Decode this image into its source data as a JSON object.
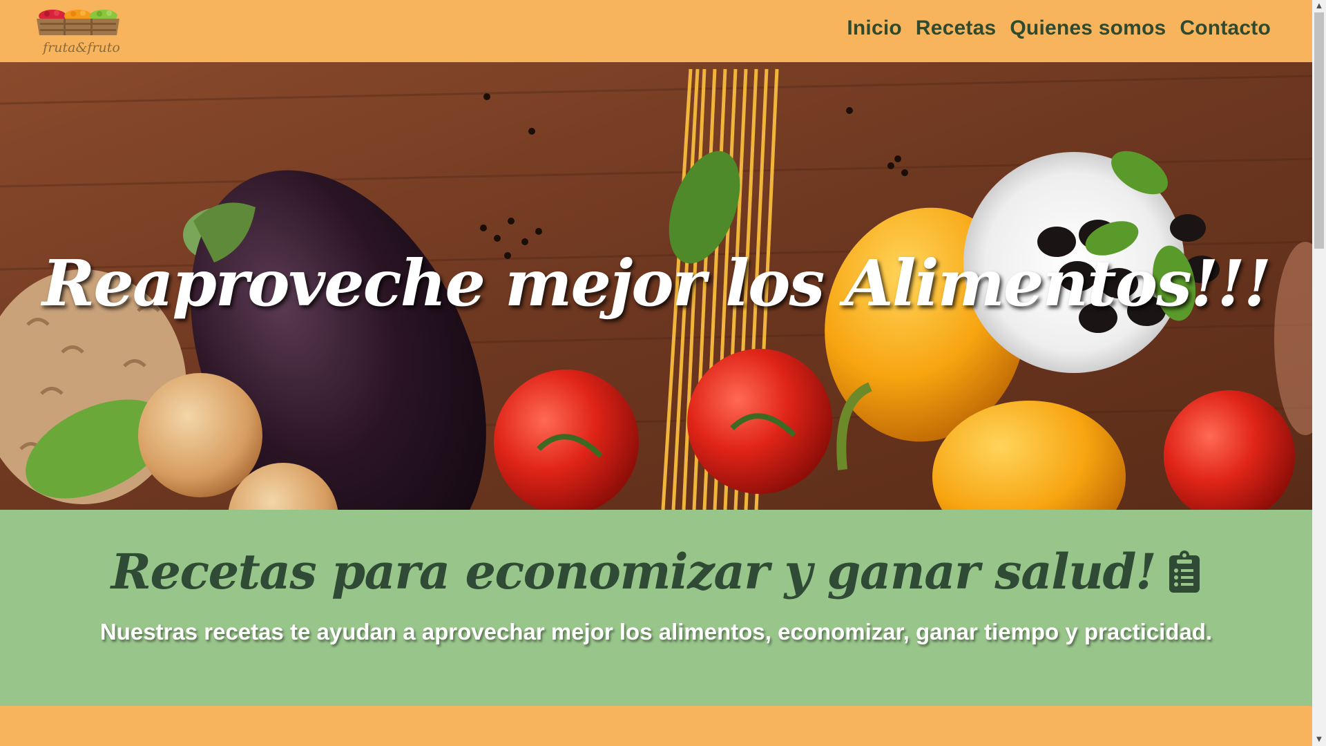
{
  "header": {
    "logo_text": "fruta&fruto",
    "nav": [
      {
        "label": "Inicio"
      },
      {
        "label": "Recetas"
      },
      {
        "label": "Quienes somos"
      },
      {
        "label": "Contacto"
      }
    ]
  },
  "hero": {
    "title": "Reaproveche mejor los Alimentos!!!"
  },
  "recipes": {
    "title": "Recetas para economizar y ganar salud!",
    "icon": "clipboard-list-icon",
    "description": "Nuestras recetas te ayudan a aprovechar mejor los alimentos, economizar, ganar tiempo y practicidad."
  },
  "colors": {
    "header_bg": "#f8b45c",
    "nav_text": "#2f4a2f",
    "section_bg": "#98c58a",
    "section_title": "#2f4a35"
  }
}
